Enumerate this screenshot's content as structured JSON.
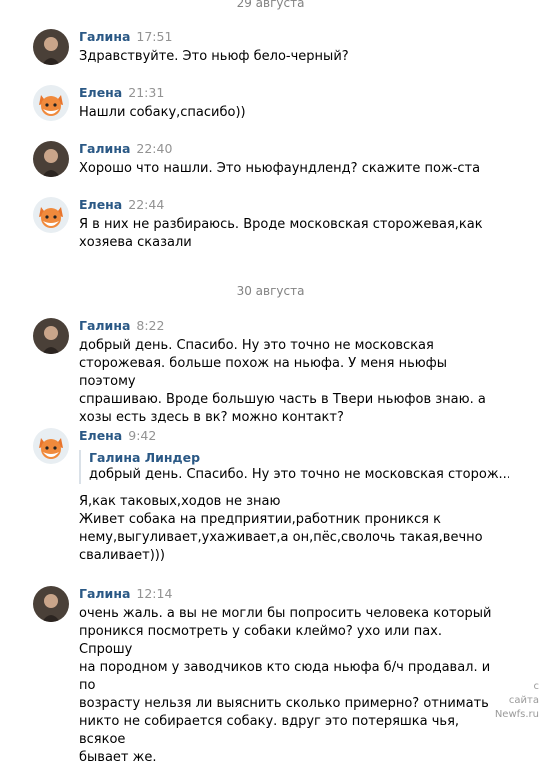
{
  "dates": [
    "29 августа",
    "30 августа"
  ],
  "messages": [
    {
      "author": "Галина",
      "time": "17:51",
      "text": "Здравствуйте. Это ньюф бело-черный?"
    },
    {
      "author": "Елена",
      "time": "21:31",
      "text": "Нашли собаку,спасибо))"
    },
    {
      "author": "Галина",
      "time": "22:40",
      "text": "Хорошо что нашли. Это ньюфаундленд? скажите пож-ста"
    },
    {
      "author": "Елена",
      "time": "22:44",
      "text": "Я в них не разбираюсь. Вроде московская сторожевая,как\nхозяева сказали"
    },
    {
      "author": "Галина",
      "time": "8:22",
      "text": "добрый день. Спасибо. Ну это точно не московская\nсторожевая. больше похож на ньюфа. У меня ньюфы поэтому\nспрашиваю. Вроде большую часть в Твери ньюфов знаю. а\nхозы есть здесь в вк? можно контакт?"
    },
    {
      "author": "Елена",
      "time": "9:42",
      "quote": {
        "author": "Галина Линдер",
        "text": "добрый день. Спасибо. Ну это точно не московская сторож..."
      },
      "text": "Я,как таковых,ходов не знаю\nЖивет собака на предприятии,работник проникся к\nнему,выгуливает,ухаживает,а он,пёс,сволочь такая,вечно\nсваливает)))"
    },
    {
      "author": "Галина",
      "time": "12:14",
      "text": "очень жаль. а вы не могли бы попросить человека который\nпроникся посмотреть у собаки клеймо? ухо или пах. Спрошу\nна породном у заводчиков кто сюда ньюфа б/ч продавал. и по\nвозрасту нельзя ли выяснить сколько примерно? отнимать\nникто не собирается собаку. вдруг это потеряшка чья, всякое\nбывает же."
    }
  ],
  "watermark": {
    "line1": "с",
    "line2": "сайта",
    "line3": "Newfs.ru"
  },
  "colors": {
    "author": "#2a5885",
    "time": "#939393",
    "date": "#828282"
  },
  "avatars": {
    "Галина": "person-photo",
    "Елена": "fox-photo"
  }
}
